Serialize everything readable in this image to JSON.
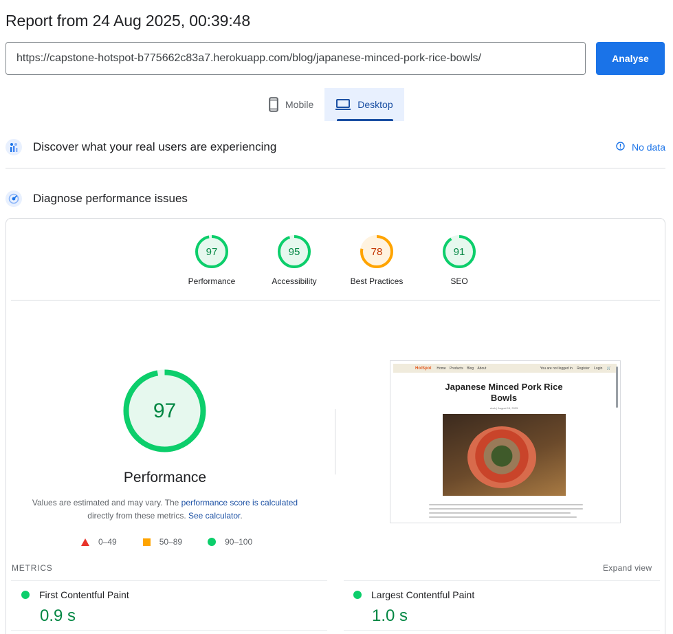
{
  "header": {
    "title": "Report from 24 Aug 2025, 00:39:48",
    "url": "https://capstone-hotspot-b775662c83a7.herokuapp.com/blog/japanese-minced-pork-rice-bowls/",
    "analyse_label": "Analyse"
  },
  "tabs": [
    {
      "label": "Mobile",
      "icon": "phone-icon",
      "active": false
    },
    {
      "label": "Desktop",
      "icon": "laptop-icon",
      "active": true
    }
  ],
  "field_data": {
    "label": "Discover what your real users are experiencing",
    "status_label": "No data",
    "status_icon": "info-icon"
  },
  "diagnose": {
    "label": "Diagnose performance issues"
  },
  "scores": [
    {
      "label": "Performance",
      "value": 97,
      "color": "#0cce6b",
      "text_color": "#018642",
      "fill": "#e6f8ee"
    },
    {
      "label": "Accessibility",
      "value": 95,
      "color": "#0cce6b",
      "text_color": "#018642",
      "fill": "#e6f8ee"
    },
    {
      "label": "Best Practices",
      "value": 78,
      "color": "#ffa400",
      "text_color": "#c33300",
      "fill": "#fff3e0"
    },
    {
      "label": "SEO",
      "value": 91,
      "color": "#0cce6b",
      "text_color": "#018642",
      "fill": "#e6f8ee"
    }
  ],
  "performance_detail": {
    "score": "97",
    "score_value": 97,
    "label": "Performance",
    "note_prefix": "Values are estimated and may vary. The ",
    "note_link1": "performance score is calculated",
    "note_middle": "directly from these metrics. ",
    "note_link2": "See calculator",
    "note_suffix": "."
  },
  "legend": [
    {
      "range": "0–49",
      "shape": "triangle",
      "color": "#e8332a"
    },
    {
      "range": "50–89",
      "shape": "square",
      "color": "#ffa400"
    },
    {
      "range": "90–100",
      "shape": "circle",
      "color": "#0cce6b"
    }
  ],
  "preview": {
    "logo": "HotSpot",
    "nav_links": [
      "Home",
      "Products",
      "Blog",
      "About"
    ],
    "nav_right": [
      "You are not logged in",
      "Register",
      "Login"
    ],
    "title": "Japanese Minced Pork Rice Bowls",
    "meta": "ckoh | August 15, 2025"
  },
  "metrics": {
    "heading": "METRICS",
    "expand_label": "Expand view",
    "items": [
      {
        "label": "First Contentful Paint",
        "value": "0.9 s",
        "status_color": "#0cce6b"
      },
      {
        "label": "Largest Contentful Paint",
        "value": "1.0 s",
        "status_color": "#0cce6b"
      }
    ]
  }
}
